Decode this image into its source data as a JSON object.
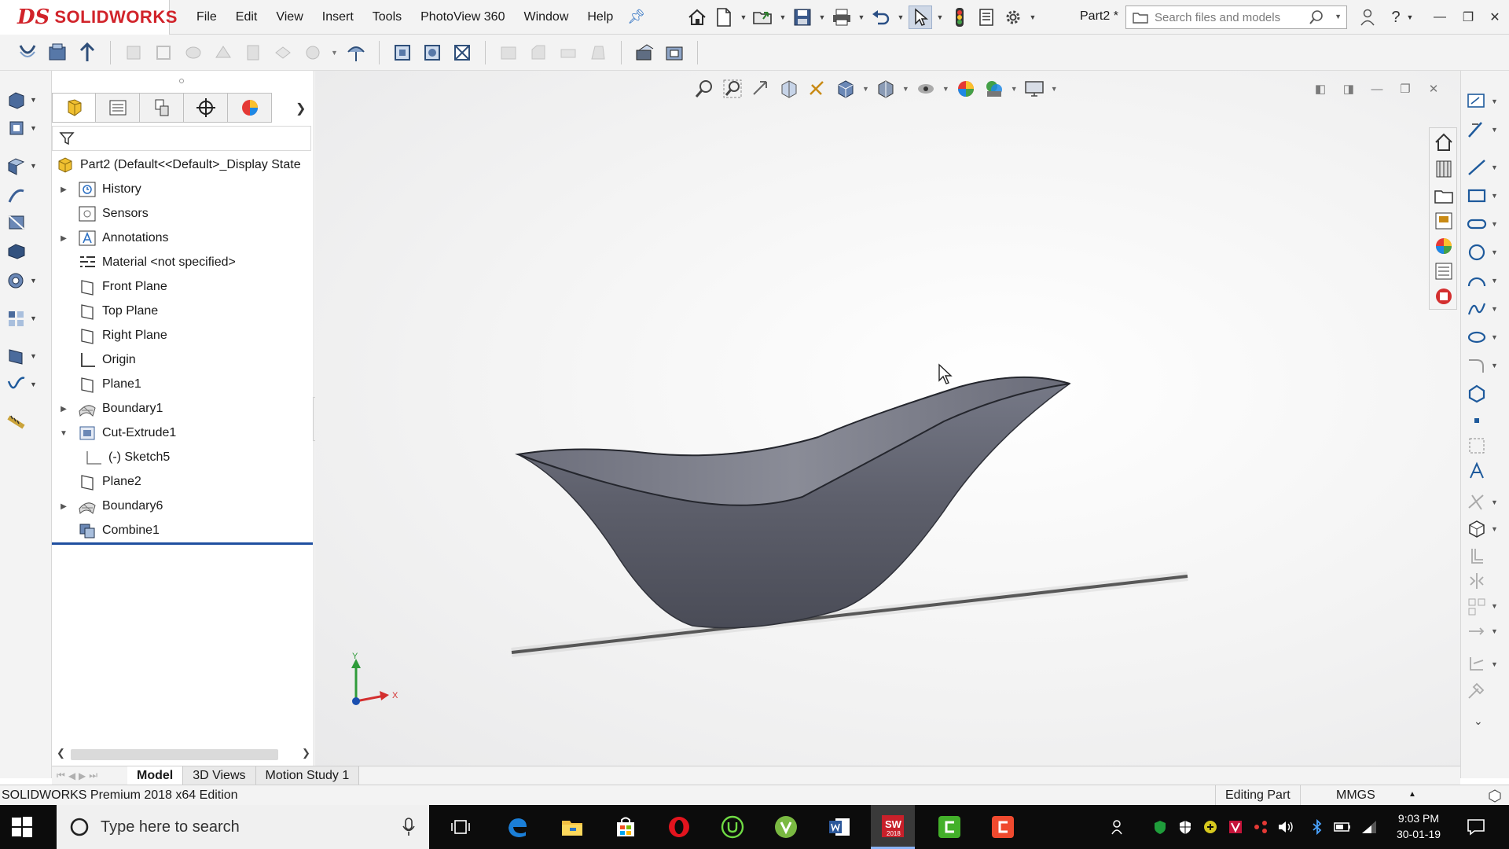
{
  "app": {
    "brand_mark": "DS",
    "brand_name": "SOLIDWORKS",
    "menus": [
      "File",
      "Edit",
      "View",
      "Insert",
      "Tools",
      "PhotoView 360",
      "Window",
      "Help"
    ],
    "doc_title": "Part2 *",
    "search_placeholder": "Search files and models"
  },
  "feature_tree": {
    "root": "Part2  (Default<<Default>_Display State",
    "items": [
      {
        "label": "History",
        "icon": "history-icon",
        "expandable": true
      },
      {
        "label": "Sensors",
        "icon": "sensors-icon",
        "expandable": false
      },
      {
        "label": "Annotations",
        "icon": "annotations-icon",
        "expandable": true
      },
      {
        "label": "Material <not specified>",
        "icon": "material-icon",
        "expandable": false
      },
      {
        "label": "Front Plane",
        "icon": "plane-icon",
        "expandable": false
      },
      {
        "label": "Top Plane",
        "icon": "plane-icon",
        "expandable": false
      },
      {
        "label": "Right Plane",
        "icon": "plane-icon",
        "expandable": false
      },
      {
        "label": "Origin",
        "icon": "origin-icon",
        "expandable": false
      },
      {
        "label": "Plane1",
        "icon": "plane-icon",
        "expandable": false
      },
      {
        "label": "Boundary1",
        "icon": "boundary-icon",
        "expandable": true
      },
      {
        "label": "Cut-Extrude1",
        "icon": "cut-extrude-icon",
        "expandable": true,
        "expanded": true
      },
      {
        "label": "(-) Sketch5",
        "icon": "sketch-icon",
        "expandable": false,
        "child": true
      },
      {
        "label": "Plane2",
        "icon": "plane-icon",
        "expandable": false
      },
      {
        "label": "Boundary6",
        "icon": "boundary-icon",
        "expandable": true
      },
      {
        "label": "Combine1",
        "icon": "combine-icon",
        "expandable": false
      }
    ]
  },
  "bottom_tabs": [
    "Model",
    "3D Views",
    "Motion Study 1"
  ],
  "status": {
    "edition": "SOLIDWORKS Premium 2018 x64 Edition",
    "mode": "Editing Part",
    "units": "MMGS"
  },
  "triad": {
    "x": "X",
    "y": "Y"
  },
  "taskbar": {
    "search_placeholder": "Type here to search",
    "time": "9:03 PM",
    "date": "30-01-19",
    "sw_badge": "2018"
  },
  "colors": {
    "accent": "#d1232a",
    "part_fill": "#5d5f6b",
    "selection_line": "#1f4fa0"
  }
}
